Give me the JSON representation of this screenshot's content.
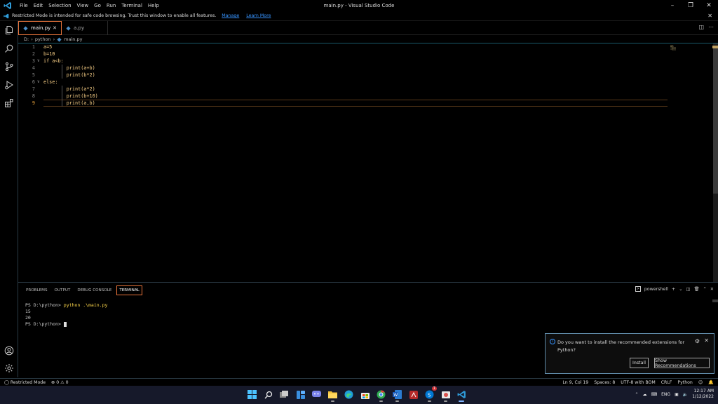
{
  "window": {
    "title": "main.py - Visual Studio Code",
    "menu": [
      "File",
      "Edit",
      "Selection",
      "View",
      "Go",
      "Run",
      "Terminal",
      "Help"
    ]
  },
  "banner": {
    "text": "Restricted Mode is intended for safe code browsing. Trust this window to enable all features.",
    "manage": "Manage",
    "learn_more": "Learn More"
  },
  "tabs": [
    {
      "label": "main.py",
      "active": true
    },
    {
      "label": "a.py",
      "active": false
    }
  ],
  "breadcrumb": {
    "drive": "D:",
    "folder": "python",
    "file": "main.py"
  },
  "editor": {
    "lines": [
      {
        "n": "1",
        "code": "a=5"
      },
      {
        "n": "2",
        "code": "b=10"
      },
      {
        "n": "3",
        "code": "if a<b:"
      },
      {
        "n": "4",
        "code": "        print(a+b)"
      },
      {
        "n": "5",
        "code": "        print(b*2)"
      },
      {
        "n": "6",
        "code": "else:"
      },
      {
        "n": "7",
        "code": "        print(a*2)"
      },
      {
        "n": "8",
        "code": "        print(b+10)"
      },
      {
        "n": "9",
        "code": "        print(a,b)"
      }
    ],
    "current_line": "9"
  },
  "panel": {
    "tabs": [
      "PROBLEMS",
      "OUTPUT",
      "DEBUG CONSOLE",
      "TERMINAL"
    ],
    "active_tab": "TERMINAL",
    "shell": "powershell",
    "terminal": {
      "prompt1": "PS D:\\python> ",
      "cmd1": "python .\\main.py",
      "out1": "15",
      "out2": "20",
      "prompt2": "PS D:\\python> "
    }
  },
  "notification": {
    "text": "Do you want to install the recommended extensions for Python?",
    "install": "Install",
    "show_recommendations": "Show Recommendations"
  },
  "status": {
    "restricted": "Restricted Mode",
    "errors": "0",
    "warnings": "0",
    "position": "Ln 9, Col 19",
    "spaces": "Spaces: 8",
    "encoding": "UTF-8 with BOM",
    "eol": "CRLF",
    "language": "Python"
  },
  "taskbar": {
    "lang": "ENG",
    "time": "12:17 AM",
    "date": "1/12/2022",
    "skype_badge": "1"
  },
  "colors": {
    "accent": "#e8743b",
    "code": "#ffd58a",
    "link": "#3794ff"
  }
}
